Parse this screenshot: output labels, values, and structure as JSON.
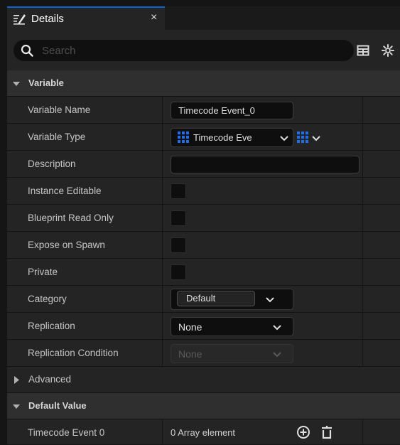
{
  "tab": {
    "title": "Details",
    "close": "×"
  },
  "search": {
    "placeholder": "Search"
  },
  "sections": {
    "variable": "Variable",
    "advanced": "Advanced",
    "default_value": "Default Value"
  },
  "rows": {
    "variable_name": {
      "label": "Variable Name",
      "value": "Timecode Event_0"
    },
    "variable_type": {
      "label": "Variable Type",
      "value": "Timecode Eve"
    },
    "description": {
      "label": "Description",
      "value": ""
    },
    "instance_editable": {
      "label": "Instance Editable"
    },
    "blueprint_read_only": {
      "label": "Blueprint Read Only"
    },
    "expose_on_spawn": {
      "label": "Expose on Spawn"
    },
    "private": {
      "label": "Private"
    },
    "category": {
      "label": "Category",
      "value": "Default"
    },
    "replication": {
      "label": "Replication",
      "value": "None"
    },
    "replication_condition": {
      "label": "Replication Condition",
      "value": "None"
    },
    "timecode_event": {
      "label": "Timecode Event 0",
      "value": "0 Array element"
    }
  },
  "colors": {
    "accent": "#0a66d6",
    "type_icon": "#1e6ff0"
  }
}
